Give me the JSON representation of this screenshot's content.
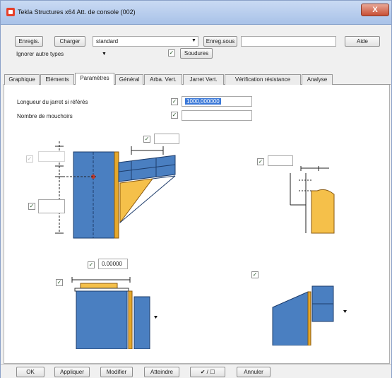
{
  "window": {
    "title": "Tekla Structures x64  Att. de console (002)",
    "close_label": "X"
  },
  "toolbar": {
    "save_label": "Enregis.",
    "load_label": "Charger",
    "preset_value": "standard",
    "save_as_label": "Enreg.sous",
    "save_as_value": "",
    "help_label": "Aide"
  },
  "options": {
    "ignore_value": "Ignorer autre types",
    "welds_label": "Soudures",
    "welds_checked": true
  },
  "tabs": [
    {
      "label": "Graphique"
    },
    {
      "label": "Eléments"
    },
    {
      "label": "Paramètres"
    },
    {
      "label": "Général"
    },
    {
      "label": "Arba. Vert."
    },
    {
      "label": "Jarret Vert."
    },
    {
      "label": "Vérification résistance"
    },
    {
      "label": "Analyse"
    }
  ],
  "active_tab": "Paramètres",
  "params": {
    "gusset_length_label": "Longueur du jarret si référés",
    "gusset_length_value": "1000,000000",
    "stiffener_count_label": "Nombre de mouchoirs",
    "stiffener_count_value": "",
    "diagram_value": "0.00000"
  },
  "footer": {
    "ok_label": "OK",
    "apply_label": "Appliquer",
    "modify_label": "Modifier",
    "get_label": "Atteindre",
    "toggle_label": "✔ / ☐",
    "cancel_label": "Annuler"
  },
  "colors": {
    "steel_blue": "#4a7fc1",
    "plate_yellow": "#f5c04a",
    "select_blue": "#3a78d8"
  }
}
